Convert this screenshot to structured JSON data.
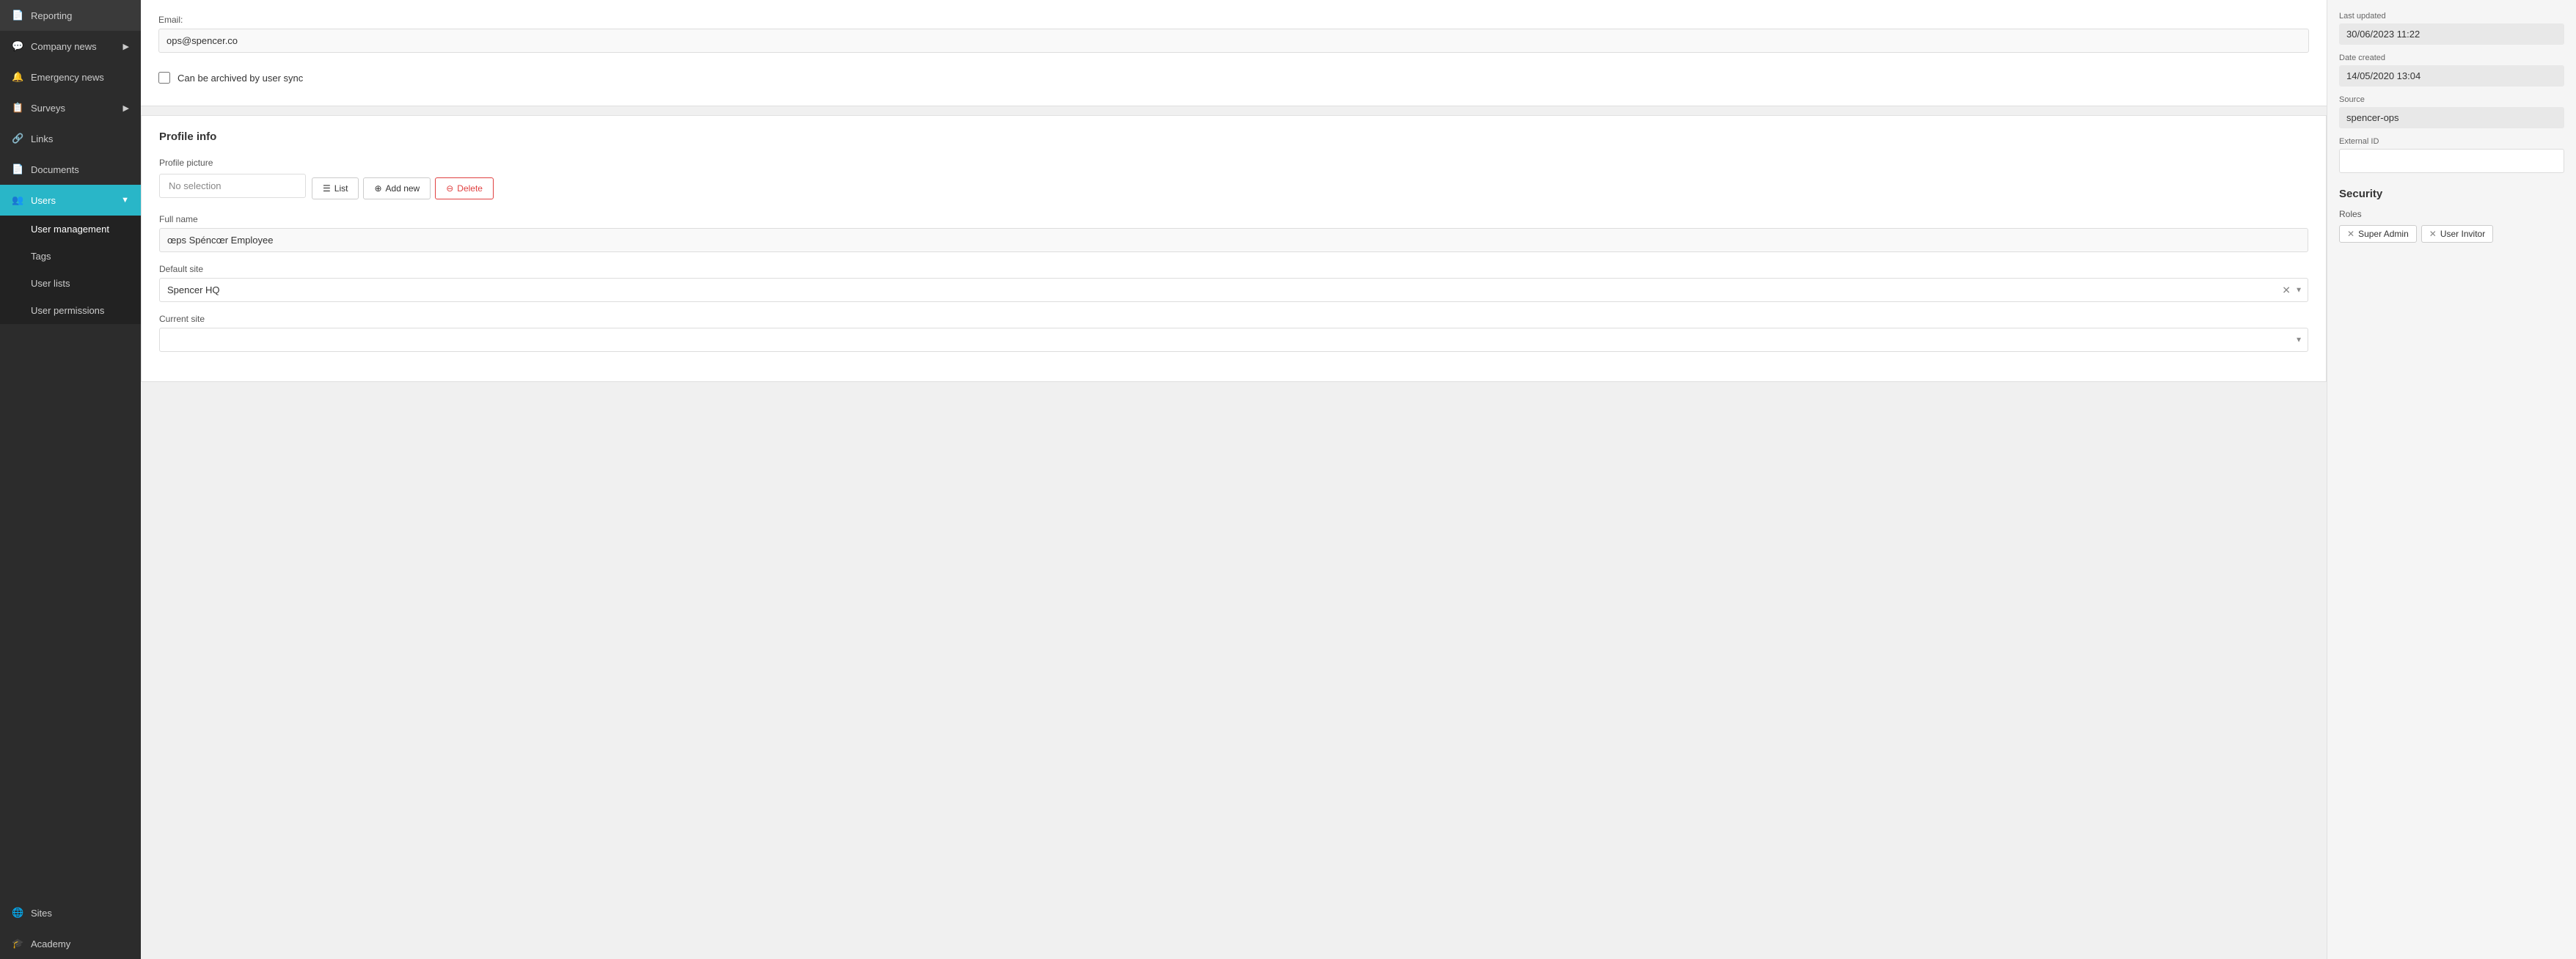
{
  "sidebar": {
    "items": [
      {
        "id": "reporting",
        "label": "Reporting",
        "icon": "📄",
        "active": false,
        "expandable": false
      },
      {
        "id": "company-news",
        "label": "Company news",
        "icon": "💬",
        "active": false,
        "expandable": true
      },
      {
        "id": "emergency-news",
        "label": "Emergency news",
        "icon": "🔔",
        "active": false,
        "expandable": false
      },
      {
        "id": "surveys",
        "label": "Surveys",
        "icon": "📋",
        "active": false,
        "expandable": true
      },
      {
        "id": "links",
        "label": "Links",
        "icon": "🔗",
        "active": false,
        "expandable": false
      },
      {
        "id": "documents",
        "label": "Documents",
        "icon": "📄",
        "active": false,
        "expandable": false
      },
      {
        "id": "users",
        "label": "Users",
        "icon": "👥",
        "active": true,
        "expandable": true
      }
    ],
    "sub_items": [
      {
        "id": "user-management",
        "label": "User management",
        "active": true
      },
      {
        "id": "tags",
        "label": "Tags",
        "active": false
      },
      {
        "id": "user-lists",
        "label": "User lists",
        "active": false
      },
      {
        "id": "user-permissions",
        "label": "User permissions",
        "active": false
      }
    ],
    "bottom_items": [
      {
        "id": "sites",
        "label": "Sites",
        "icon": "🌐"
      },
      {
        "id": "academy",
        "label": "Academy",
        "icon": "🎓"
      }
    ]
  },
  "form": {
    "email_label": "Email:",
    "email_value": "ops@spencer.co",
    "archive_checkbox_label": "Can be archived by user sync",
    "profile_section_title": "Profile info",
    "profile_picture_label": "Profile picture",
    "no_selection_text": "No selection",
    "btn_list": "List",
    "btn_add_new": "Add new",
    "btn_delete": "Delete",
    "full_name_label": "Full name",
    "full_name_value": "œps Spéncœr Employee",
    "default_site_label": "Default site",
    "default_site_value": "Spencer HQ",
    "current_site_label": "Current site",
    "current_site_value": ""
  },
  "right_panel": {
    "last_updated_label": "Last updated",
    "last_updated_value": "30/06/2023 11:22",
    "date_created_label": "Date created",
    "date_created_value": "14/05/2020 13:04",
    "source_label": "Source",
    "source_value": "spencer-ops",
    "external_id_label": "External ID",
    "external_id_value": "",
    "security_title": "Security",
    "roles_label": "Roles",
    "roles": [
      {
        "label": "Super Admin"
      },
      {
        "label": "User Invitor"
      }
    ]
  }
}
